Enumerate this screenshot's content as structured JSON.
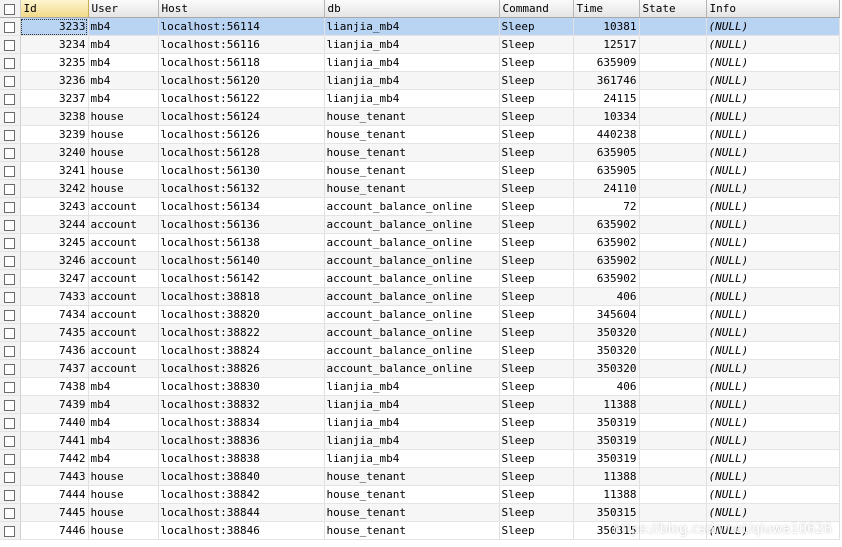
{
  "columns": [
    "Id",
    "User",
    "Host",
    "db",
    "Command",
    "Time",
    "State",
    "Info"
  ],
  "selected_row_index": 0,
  "rows": [
    {
      "id": "3233",
      "user": "mb4",
      "host": "localhost:56114",
      "db": "lianjia_mb4",
      "command": "Sleep",
      "time": "10381",
      "state": "",
      "info": "(NULL)"
    },
    {
      "id": "3234",
      "user": "mb4",
      "host": "localhost:56116",
      "db": "lianjia_mb4",
      "command": "Sleep",
      "time": "12517",
      "state": "",
      "info": "(NULL)"
    },
    {
      "id": "3235",
      "user": "mb4",
      "host": "localhost:56118",
      "db": "lianjia_mb4",
      "command": "Sleep",
      "time": "635909",
      "state": "",
      "info": "(NULL)"
    },
    {
      "id": "3236",
      "user": "mb4",
      "host": "localhost:56120",
      "db": "lianjia_mb4",
      "command": "Sleep",
      "time": "361746",
      "state": "",
      "info": "(NULL)"
    },
    {
      "id": "3237",
      "user": "mb4",
      "host": "localhost:56122",
      "db": "lianjia_mb4",
      "command": "Sleep",
      "time": "24115",
      "state": "",
      "info": "(NULL)"
    },
    {
      "id": "3238",
      "user": "house",
      "host": "localhost:56124",
      "db": "house_tenant",
      "command": "Sleep",
      "time": "10334",
      "state": "",
      "info": "(NULL)"
    },
    {
      "id": "3239",
      "user": "house",
      "host": "localhost:56126",
      "db": "house_tenant",
      "command": "Sleep",
      "time": "440238",
      "state": "",
      "info": "(NULL)"
    },
    {
      "id": "3240",
      "user": "house",
      "host": "localhost:56128",
      "db": "house_tenant",
      "command": "Sleep",
      "time": "635905",
      "state": "",
      "info": "(NULL)"
    },
    {
      "id": "3241",
      "user": "house",
      "host": "localhost:56130",
      "db": "house_tenant",
      "command": "Sleep",
      "time": "635905",
      "state": "",
      "info": "(NULL)"
    },
    {
      "id": "3242",
      "user": "house",
      "host": "localhost:56132",
      "db": "house_tenant",
      "command": "Sleep",
      "time": "24110",
      "state": "",
      "info": "(NULL)"
    },
    {
      "id": "3243",
      "user": "account",
      "host": "localhost:56134",
      "db": "account_balance_online",
      "command": "Sleep",
      "time": "72",
      "state": "",
      "info": "(NULL)"
    },
    {
      "id": "3244",
      "user": "account",
      "host": "localhost:56136",
      "db": "account_balance_online",
      "command": "Sleep",
      "time": "635902",
      "state": "",
      "info": "(NULL)"
    },
    {
      "id": "3245",
      "user": "account",
      "host": "localhost:56138",
      "db": "account_balance_online",
      "command": "Sleep",
      "time": "635902",
      "state": "",
      "info": "(NULL)"
    },
    {
      "id": "3246",
      "user": "account",
      "host": "localhost:56140",
      "db": "account_balance_online",
      "command": "Sleep",
      "time": "635902",
      "state": "",
      "info": "(NULL)"
    },
    {
      "id": "3247",
      "user": "account",
      "host": "localhost:56142",
      "db": "account_balance_online",
      "command": "Sleep",
      "time": "635902",
      "state": "",
      "info": "(NULL)"
    },
    {
      "id": "7433",
      "user": "account",
      "host": "localhost:38818",
      "db": "account_balance_online",
      "command": "Sleep",
      "time": "406",
      "state": "",
      "info": "(NULL)"
    },
    {
      "id": "7434",
      "user": "account",
      "host": "localhost:38820",
      "db": "account_balance_online",
      "command": "Sleep",
      "time": "345604",
      "state": "",
      "info": "(NULL)"
    },
    {
      "id": "7435",
      "user": "account",
      "host": "localhost:38822",
      "db": "account_balance_online",
      "command": "Sleep",
      "time": "350320",
      "state": "",
      "info": "(NULL)"
    },
    {
      "id": "7436",
      "user": "account",
      "host": "localhost:38824",
      "db": "account_balance_online",
      "command": "Sleep",
      "time": "350320",
      "state": "",
      "info": "(NULL)"
    },
    {
      "id": "7437",
      "user": "account",
      "host": "localhost:38826",
      "db": "account_balance_online",
      "command": "Sleep",
      "time": "350320",
      "state": "",
      "info": "(NULL)"
    },
    {
      "id": "7438",
      "user": "mb4",
      "host": "localhost:38830",
      "db": "lianjia_mb4",
      "command": "Sleep",
      "time": "406",
      "state": "",
      "info": "(NULL)"
    },
    {
      "id": "7439",
      "user": "mb4",
      "host": "localhost:38832",
      "db": "lianjia_mb4",
      "command": "Sleep",
      "time": "11388",
      "state": "",
      "info": "(NULL)"
    },
    {
      "id": "7440",
      "user": "mb4",
      "host": "localhost:38834",
      "db": "lianjia_mb4",
      "command": "Sleep",
      "time": "350319",
      "state": "",
      "info": "(NULL)"
    },
    {
      "id": "7441",
      "user": "mb4",
      "host": "localhost:38836",
      "db": "lianjia_mb4",
      "command": "Sleep",
      "time": "350319",
      "state": "",
      "info": "(NULL)"
    },
    {
      "id": "7442",
      "user": "mb4",
      "host": "localhost:38838",
      "db": "lianjia_mb4",
      "command": "Sleep",
      "time": "350319",
      "state": "",
      "info": "(NULL)"
    },
    {
      "id": "7443",
      "user": "house",
      "host": "localhost:38840",
      "db": "house_tenant",
      "command": "Sleep",
      "time": "11388",
      "state": "",
      "info": "(NULL)"
    },
    {
      "id": "7444",
      "user": "house",
      "host": "localhost:38842",
      "db": "house_tenant",
      "command": "Sleep",
      "time": "11388",
      "state": "",
      "info": "(NULL)"
    },
    {
      "id": "7445",
      "user": "house",
      "host": "localhost:38844",
      "db": "house_tenant",
      "command": "Sleep",
      "time": "350315",
      "state": "",
      "info": "(NULL)"
    },
    {
      "id": "7446",
      "user": "house",
      "host": "localhost:38846",
      "db": "house_tenant",
      "command": "Sleep",
      "time": "350315",
      "state": "",
      "info": "(NULL)"
    }
  ],
  "watermark": "https://blog.csdn.net/qiuwa10626"
}
